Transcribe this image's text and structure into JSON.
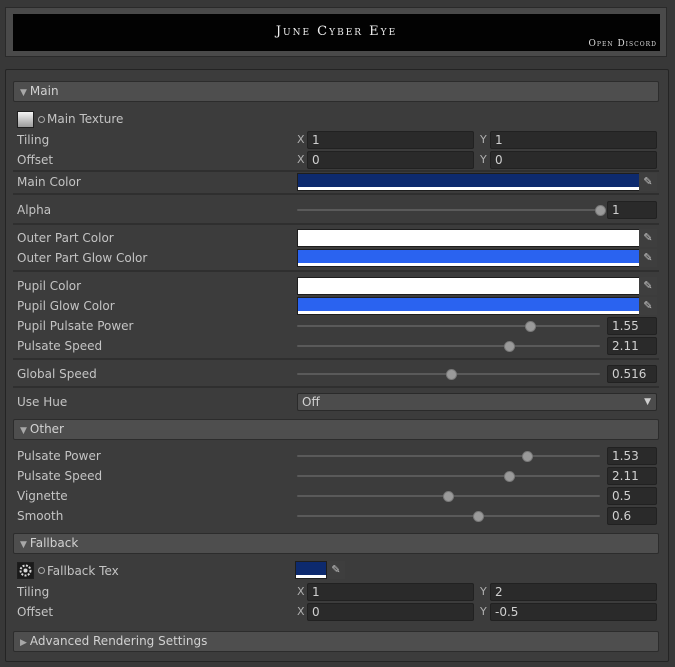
{
  "header": {
    "title": "June Cyber Eye",
    "link": "Open Discord"
  },
  "sections": {
    "main": "Main",
    "other": "Other",
    "fallback": "Fallback",
    "advanced": "Advanced Rendering Settings"
  },
  "main": {
    "main_texture_label": "Main Texture",
    "tiling_label": "Tiling",
    "tiling_x": "1",
    "tiling_y": "1",
    "offset_label": "Offset",
    "offset_x": "0",
    "offset_y": "0",
    "axis_x": "X",
    "axis_y": "Y",
    "main_color_label": "Main Color",
    "main_color": "#0d2a6e",
    "alpha_label": "Alpha",
    "alpha_value": "1",
    "alpha_fraction": 1.0,
    "outer_part_color_label": "Outer Part Color",
    "outer_part_color": "#ffffff",
    "outer_part_glow_color_label": "Outer Part Glow Color",
    "outer_part_glow_color": "#2a63f0",
    "pupil_color_label": "Pupil Color",
    "pupil_color": "#ffffff",
    "pupil_glow_color_label": "Pupil Glow Color",
    "pupil_glow_color": "#2a63f0",
    "pupil_pulsate_power_label": "Pupil Pulsate Power",
    "pupil_pulsate_power_value": "1.55",
    "pupil_pulsate_power_fraction": 0.77,
    "pulsate_speed_label": "Pulsate Speed",
    "pulsate_speed_value": "2.11",
    "pulsate_speed_fraction": 0.7,
    "global_speed_label": "Global Speed",
    "global_speed_value": "0.516",
    "global_speed_fraction": 0.51,
    "use_hue_label": "Use Hue",
    "use_hue_value": "Off"
  },
  "other": {
    "pulsate_power_label": "Pulsate Power",
    "pulsate_power_value": "1.53",
    "pulsate_power_fraction": 0.76,
    "pulsate_speed_label": "Pulsate Speed",
    "pulsate_speed_value": "2.11",
    "pulsate_speed_fraction": 0.7,
    "vignette_label": "Vignette",
    "vignette_value": "0.5",
    "vignette_fraction": 0.5,
    "smooth_label": "Smooth",
    "smooth_value": "0.6",
    "smooth_fraction": 0.6
  },
  "fallback": {
    "fallback_tex_label": "Fallback Tex",
    "fallback_color": "#0d2a6e",
    "tiling_label": "Tiling",
    "tiling_x": "1",
    "tiling_y": "2",
    "offset_label": "Offset",
    "offset_x": "0",
    "offset_y": "-0.5"
  },
  "icons": {
    "eyedropper": "eyedropper-icon",
    "foldout_open": "triangle-down-icon",
    "foldout_closed": "triangle-right-icon",
    "dropdown": "chevron-down-icon"
  }
}
